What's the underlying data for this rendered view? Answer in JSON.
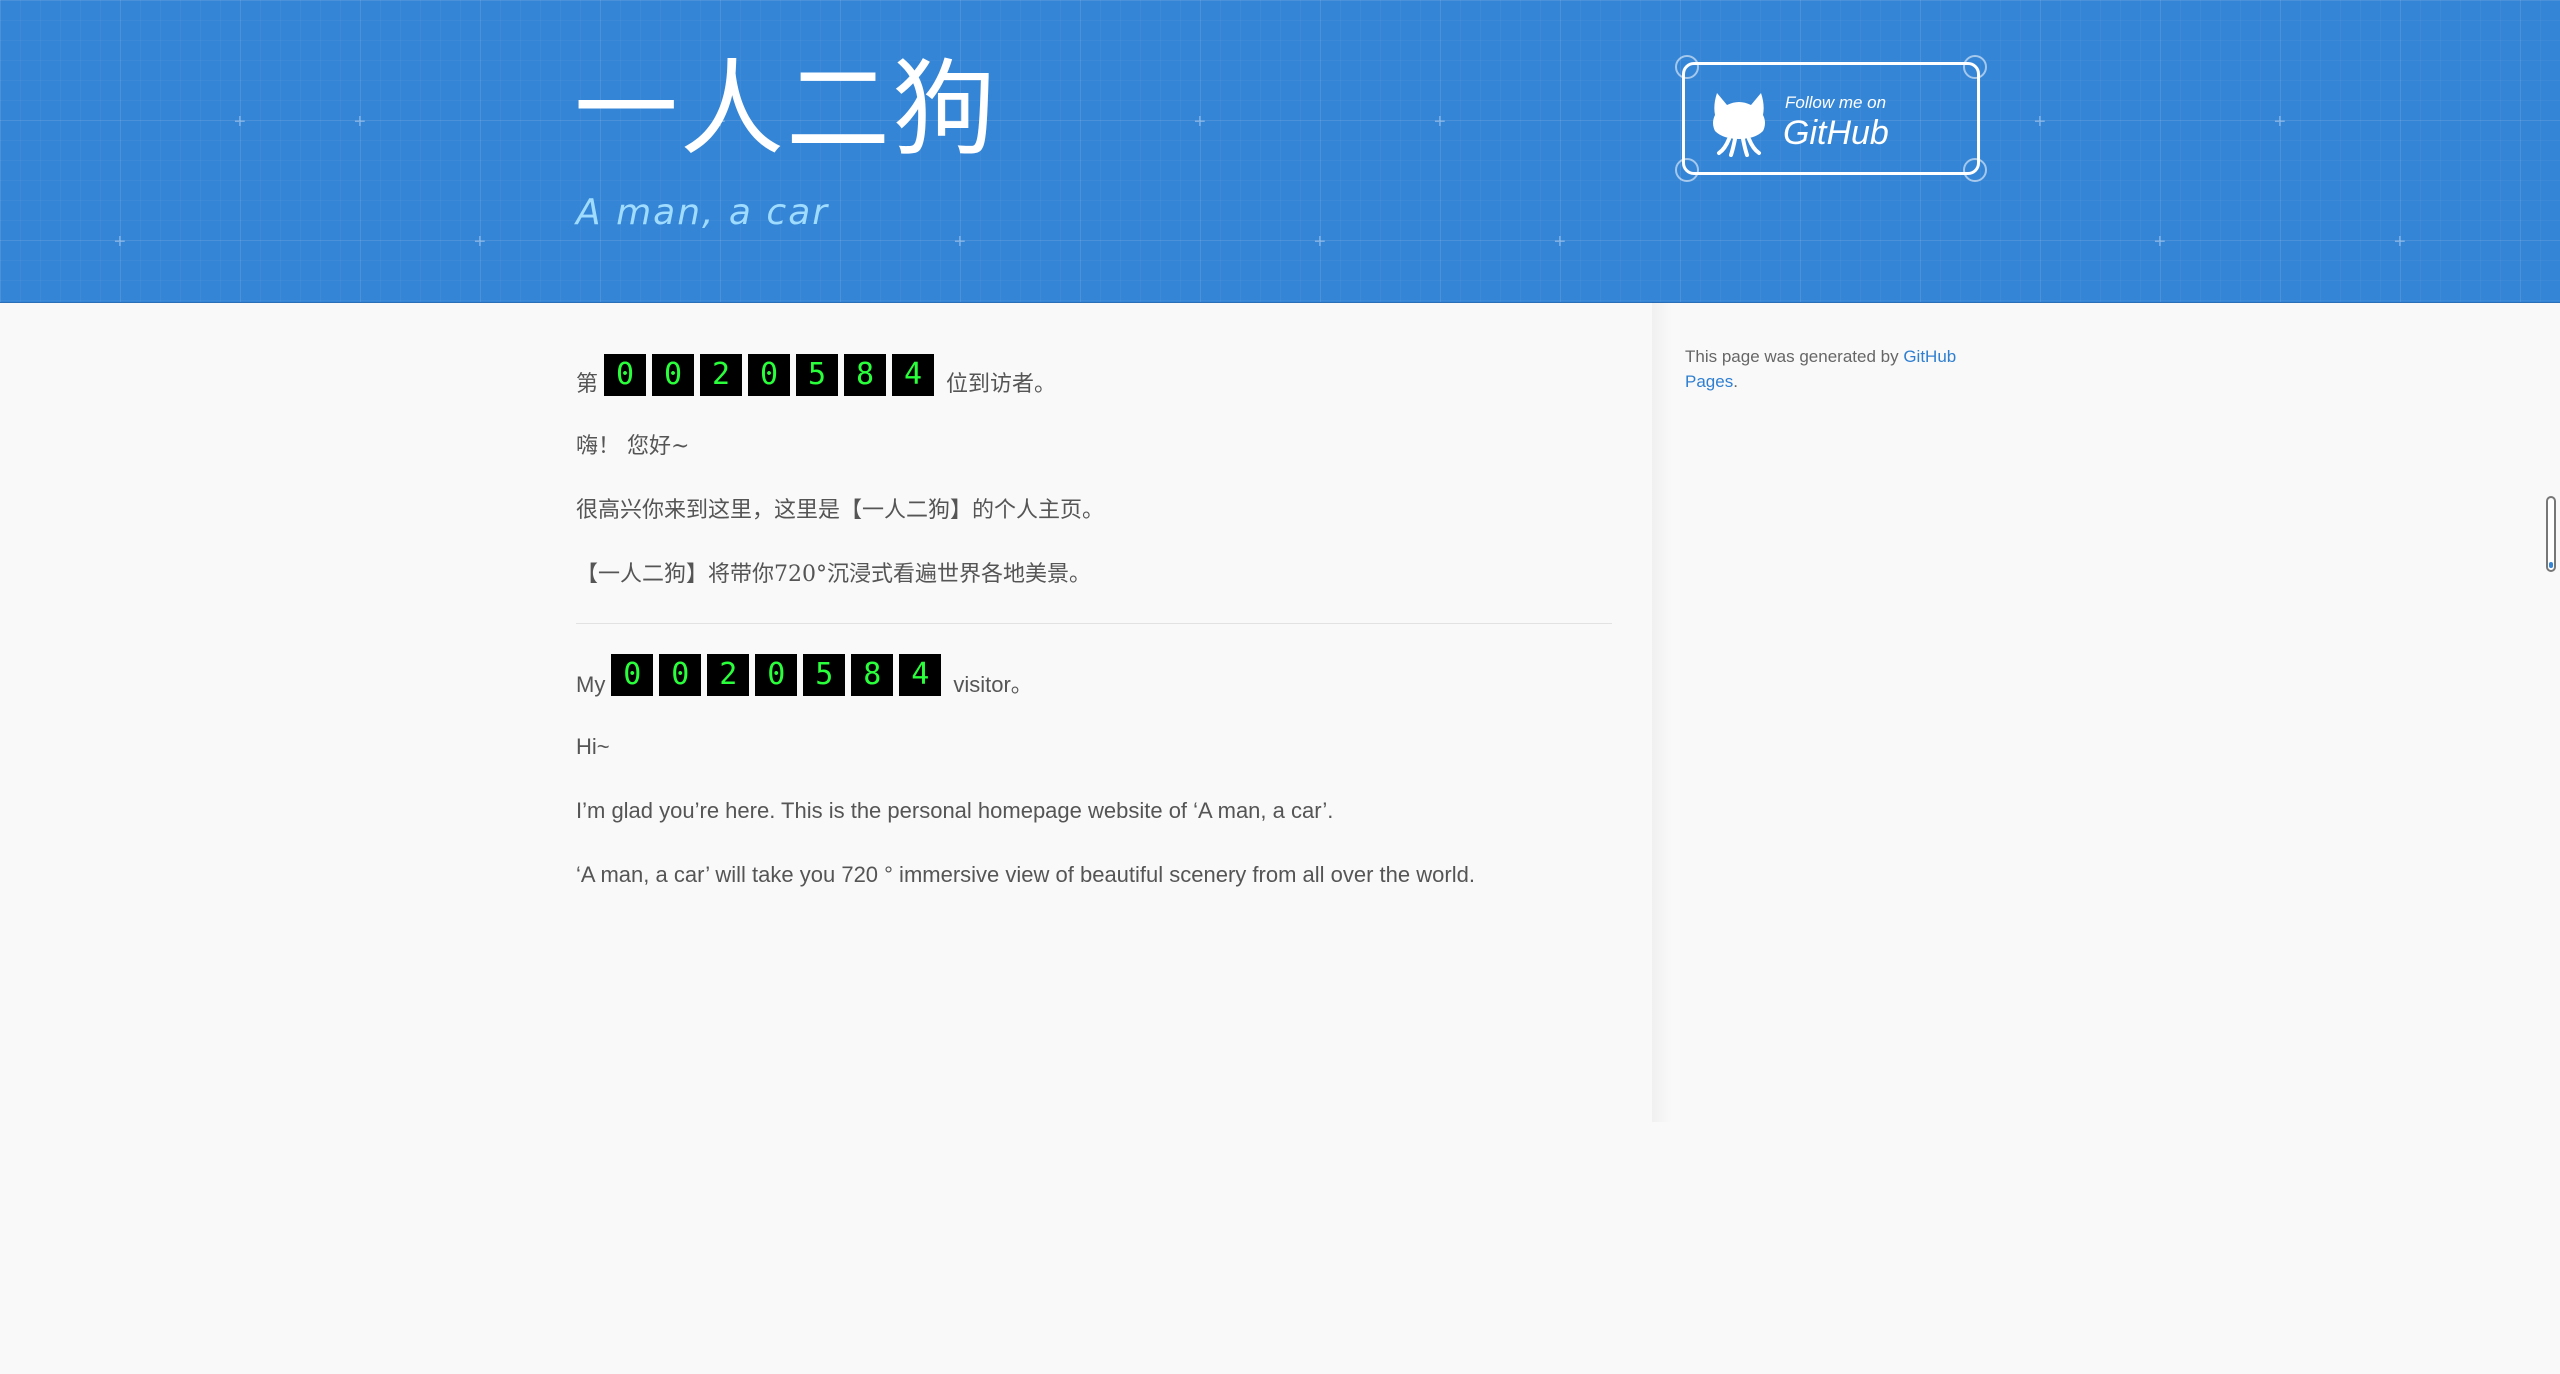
{
  "header": {
    "title": "一人二狗",
    "subtitle": "A man, a car",
    "github_button": {
      "follow_text": "Follow me on",
      "brand_text": "GitHub",
      "icon": "octocat-icon"
    }
  },
  "main": {
    "chinese": {
      "counter_prefix": "第",
      "counter_suffix": "位到访者。",
      "greeting": "嗨！ 您好~",
      "welcome": "很高兴你来到这里，这里是【一人二狗】的个人主页。",
      "tagline": "【一人二狗】将带你720°沉浸式看遍世界各地美景。"
    },
    "english": {
      "counter_prefix": "My",
      "counter_suffix": "visitor。",
      "greeting": "Hi~",
      "welcome": "I’m glad you’re here. This is the personal homepage website of ‘A man, a car’.",
      "tagline": "‘A man, a car’ will take you 720 ° immersive view of beautiful scenery from all over the world."
    },
    "visitor_digits": [
      "0",
      "0",
      "2",
      "0",
      "5",
      "8",
      "4"
    ]
  },
  "sidebar": {
    "generated_prefix": "This page was generated by ",
    "link_text": "GitHub Pages",
    "generated_suffix": "."
  },
  "colors": {
    "header_bg": "#3585d6",
    "subtitle": "#9fdcff",
    "counter_digit": "#29ff3a",
    "link": "#2f7fd1"
  }
}
